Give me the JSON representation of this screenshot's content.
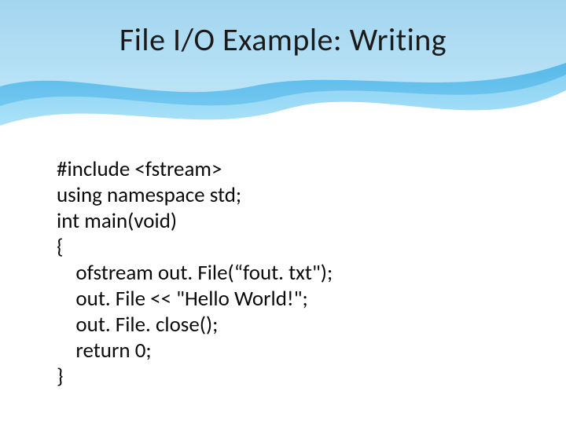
{
  "title": "File I/O Example: Writing",
  "code": {
    "l0": "#include <fstream>",
    "l1": "using namespace std;",
    "l2": "int main(void)",
    "l3": "{",
    "l4": "    ofstream out. File(“fout. txt\");",
    "l5": "    out. File << \"Hello World!\";",
    "l6": "    out. File. close();",
    "l7": "    return 0;",
    "l8": "}"
  }
}
